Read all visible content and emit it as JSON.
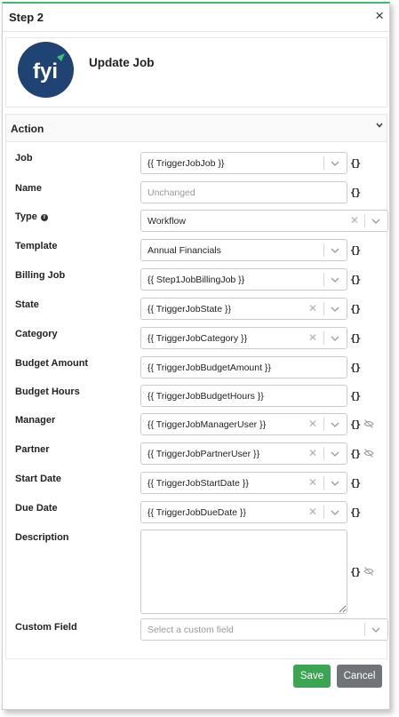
{
  "header": {
    "title": "Step 2",
    "close_icon": "×"
  },
  "card": {
    "title": "Update Job",
    "logo_text": "fyi"
  },
  "section": {
    "title": "Action"
  },
  "fields": {
    "job": {
      "label": "Job",
      "value": "{{ TriggerJobJob }}"
    },
    "name": {
      "label": "Name",
      "placeholder": "Unchanged"
    },
    "type": {
      "label": "Type",
      "value": "Workflow"
    },
    "template": {
      "label": "Template",
      "value": "Annual Financials"
    },
    "billing_job": {
      "label": "Billing Job",
      "value": "{{ Step1JobBillingJob }}"
    },
    "state": {
      "label": "State",
      "value": "{{ TriggerJobState }}"
    },
    "category": {
      "label": "Category",
      "value": "{{ TriggerJobCategory }}"
    },
    "budget_amount": {
      "label": "Budget Amount",
      "value": "{{ TriggerJobBudgetAmount }}"
    },
    "budget_hours": {
      "label": "Budget Hours",
      "value": "{{ TriggerJobBudgetHours }}"
    },
    "manager": {
      "label": "Manager",
      "value": "{{ TriggerJobManagerUser }}"
    },
    "partner": {
      "label": "Partner",
      "value": "{{ TriggerJobPartnerUser }}"
    },
    "start_date": {
      "label": "Start Date",
      "value": "{{ TriggerJobStartDate }}"
    },
    "due_date": {
      "label": "Due Date",
      "value": "{{ TriggerJobDueDate }}"
    },
    "description": {
      "label": "Description",
      "value": ""
    },
    "custom_field": {
      "label": "Custom Field",
      "placeholder": "Select a custom field"
    }
  },
  "braces_text": "{}",
  "buttons": {
    "save": "Save",
    "cancel": "Cancel"
  },
  "colors": {
    "accent": "#3dbb6a",
    "save": "#3ca553",
    "cancel": "#6e7478",
    "logo_bg": "#1f4474",
    "logo_leaf": "#3ec36c"
  }
}
